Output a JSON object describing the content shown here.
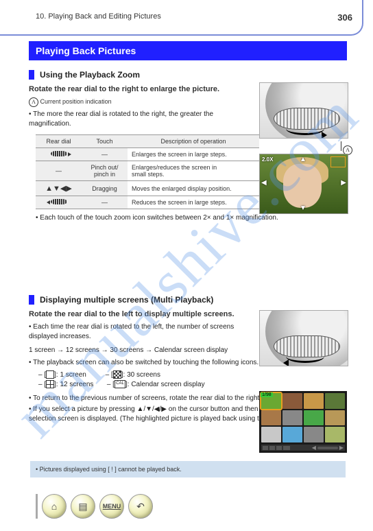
{
  "header": {
    "breadcrumb": "10. Playing Back and Editing Pictures",
    "page_number": "306"
  },
  "title_bar": "Playing Back Pictures",
  "watermark": "manualshive.com",
  "section1": {
    "title": "Using the Playback Zoom",
    "body_line1": "Rotate the rear dial to the right to enlarge the picture.",
    "marker_legend": "Current position indication",
    "bullet1": "The more the rear dial is rotated to the right, the greater the magnification.",
    "table_header_rear": "Rear dial",
    "table_header_touch": "Touch",
    "table_header_desc": "Description of operation",
    "row1_desc": "Enlarges the screen in large steps.",
    "row2_label": "Pinch out/\npinch in",
    "row2_desc": "Enlarges/reduces the screen in\nsmall steps.",
    "row3_icons": "▲▼◀▶",
    "row3_label": "Dragging",
    "row3_desc": "Moves the enlarged display position.",
    "row4_desc": "Reduces the screen in large steps.",
    "footer_bullet": "Each touch of the touch zoom icon switches between 2× and 1× magnification.",
    "photo_mag": "2.0X"
  },
  "section2": {
    "title": "Displaying multiple screens (Multi Playback)",
    "body1": "Rotate the rear dial to the left to display multiple screens.",
    "bullet1": "Each time the rear dial is rotated to the left, the number of screens displayed increases.",
    "line2_prefix": "1 screen ",
    "line2_mid": " 12 screens ",
    "line2_mid2": " 30 screens ",
    "line2_end": " Calendar screen display",
    "bullet2": "To return to the previous number of screens, rotate the rear dial to the right.",
    "bullet3": "If you select a picture by pressing ▲/▼/◀/▶ on the cursor button and then press [MENU/SET], the selection screen is displayed. (The highlighted picture is played back using the full screen.)",
    "bullet_touch": "The playback screen can also be switched by touching the following icons.",
    "icon_labels": {
      "single": "1 screen",
      "twelve": "12 screens",
      "thirty": "30 screens",
      "cal": "Calendar screen display"
    },
    "thumb_badge": "1/98"
  },
  "note": "Pictures displayed using [ ! ] cannot be played back.",
  "nav": {
    "home": "⌂",
    "list": "▤",
    "menu": "MENU",
    "back": "↶"
  },
  "marker_a": "A"
}
